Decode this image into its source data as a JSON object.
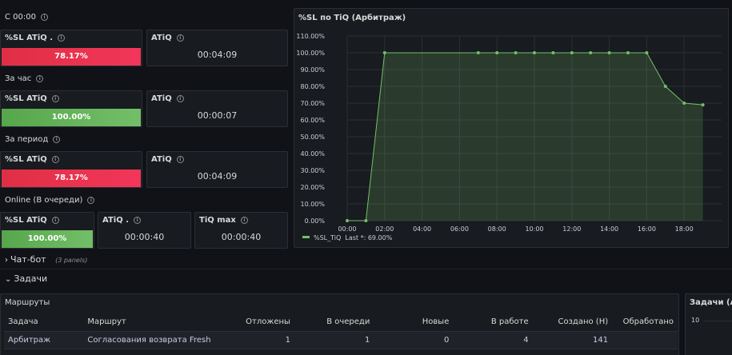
{
  "sections": {
    "since_start": "С 00:00",
    "hour": "За час",
    "period": "За период",
    "online": "Online (В очереди)"
  },
  "stats": {
    "since_start": {
      "sl_title": "%SL ATiQ .",
      "sl_value": "78.17%",
      "atiq_title": "ATiQ",
      "atiq_value": "00:04:09"
    },
    "hour": {
      "sl_title": "%SL ATiQ",
      "sl_value": "100.00%",
      "atiq_title": "ATiQ",
      "atiq_value": "00:00:07"
    },
    "period": {
      "sl_title": "%SL ATiQ",
      "sl_value": "78.17%",
      "atiq_title": "ATiQ",
      "atiq_value": "00:04:09"
    },
    "online": {
      "sl_title": "%SL ATiQ",
      "sl_value": "100.00%",
      "atiq_title": "ATiQ .",
      "atiq_value": "00:00:40",
      "tiq_title": "TiQ max",
      "tiq_value": "00:00:40"
    }
  },
  "colors": {
    "red": "#e02f44",
    "green": "#73bf69",
    "background": "#111217",
    "panel": "#181b1f"
  },
  "chart_panel": {
    "title": "%SL по TiQ (Арбитраж)",
    "legend_name": "%SL_TiQ",
    "legend_last": "Last *: 69.00%"
  },
  "chart_data": {
    "type": "area",
    "title": "%SL по TiQ (Арбитраж)",
    "ylim": [
      0,
      110
    ],
    "y_ticks": [
      "0.00%",
      "10.00%",
      "20.00%",
      "30.00%",
      "40.00%",
      "50.00%",
      "60.00%",
      "70.00%",
      "80.00%",
      "90.00%",
      "100.00%",
      "110.00%"
    ],
    "xlim": [
      0,
      20
    ],
    "x_ticks": [
      "00:00",
      "02:00",
      "04:00",
      "06:00",
      "08:00",
      "10:00",
      "12:00",
      "14:00",
      "16:00",
      "18:00"
    ],
    "grid": true,
    "legend_placement": "bottom-left",
    "series": [
      {
        "name": "%SL_TiQ",
        "color": "#73bf69",
        "x": [
          0,
          1,
          2,
          7,
          8,
          9,
          10,
          11,
          12,
          13,
          14,
          15,
          16,
          17,
          18,
          19
        ],
        "values": [
          0,
          0,
          100,
          100,
          100,
          100,
          100,
          100,
          100,
          100,
          100,
          100,
          100,
          80,
          70,
          69
        ],
        "markers": [
          true,
          true,
          true,
          true,
          true,
          true,
          true,
          true,
          true,
          true,
          true,
          true,
          true,
          true,
          true,
          true
        ],
        "marker_flags": null
      }
    ]
  },
  "rows": {
    "chatbot_label": "Чат-бот",
    "chatbot_count": "(3 panels)",
    "tasks_label": "Задачи"
  },
  "routes_panel": {
    "title": "Маршруты",
    "columns": [
      "Задача",
      "Маршрут",
      "Отложены",
      "В очереди",
      "Новые",
      "В работе",
      "Создано (Н)",
      "Обработано"
    ],
    "rows": [
      [
        "Арбитраж",
        "Согласования возврата Fresh",
        "1",
        "1",
        "0",
        "4",
        "141",
        ""
      ]
    ]
  },
  "tasks_panel": {
    "title": "Задачи (Ар",
    "y_top": "10"
  },
  "icons": {
    "info": "info-circle-icon",
    "chevron_right": "chevron-right-icon",
    "chevron_down": "chevron-down-icon"
  },
  "glyphs": {
    "info": "i",
    "chevron_right": "›",
    "chevron_down": "⌄"
  }
}
